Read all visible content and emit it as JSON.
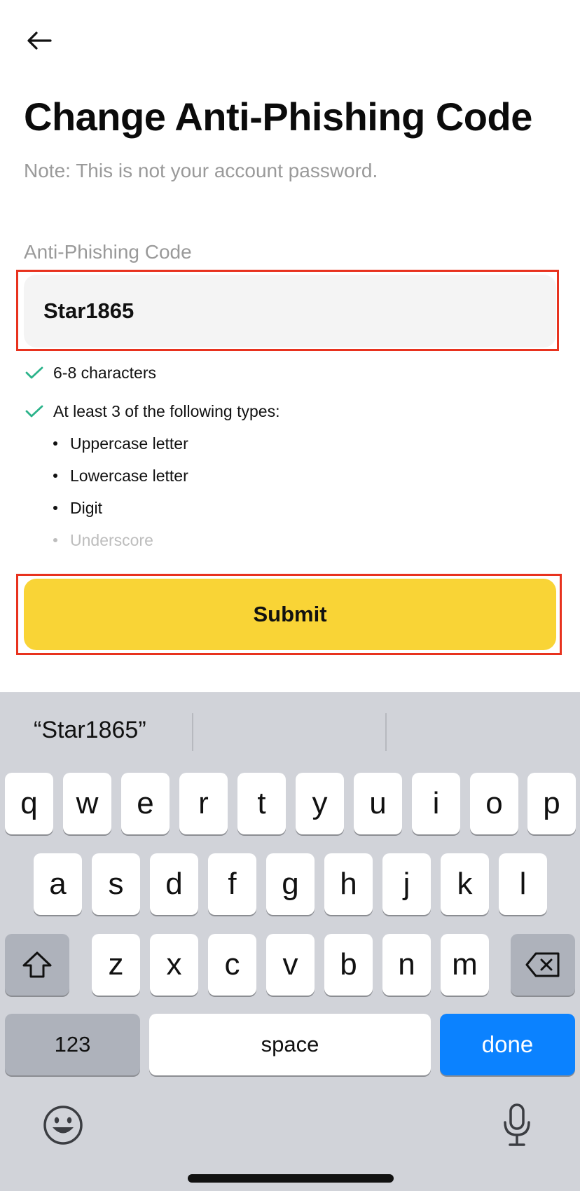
{
  "header": {
    "back_icon": "arrow-left-icon",
    "title": "Change Anti-Phishing Code",
    "note": "Note: This is not your account password."
  },
  "form": {
    "field_label": "Anti-Phishing Code",
    "field_value": "Star1865",
    "rules": [
      {
        "text": "6-8 characters",
        "met": true
      },
      {
        "text": "At least 3 of the following types:",
        "met": true
      }
    ],
    "types": [
      {
        "text": "Uppercase letter",
        "met": true
      },
      {
        "text": "Lowercase letter",
        "met": true
      },
      {
        "text": "Digit",
        "met": true
      },
      {
        "text": "Underscore",
        "met": false
      }
    ],
    "submit_label": "Submit"
  },
  "keyboard": {
    "suggestion": "“Star1865”",
    "row1": [
      "q",
      "w",
      "e",
      "r",
      "t",
      "y",
      "u",
      "i",
      "o",
      "p"
    ],
    "row2": [
      "a",
      "s",
      "d",
      "f",
      "g",
      "h",
      "j",
      "k",
      "l"
    ],
    "row3": [
      "z",
      "x",
      "c",
      "v",
      "b",
      "n",
      "m"
    ],
    "numbers_label": "123",
    "space_label": "space",
    "done_label": "done",
    "shift_icon": "shift-icon",
    "backspace_icon": "backspace-icon",
    "emoji_icon": "emoji-icon",
    "mic_icon": "microphone-icon"
  },
  "colors": {
    "accent": "#f9d436",
    "highlight": "#e8321e",
    "check": "#2bb38a",
    "done_key": "#0b82ff"
  }
}
